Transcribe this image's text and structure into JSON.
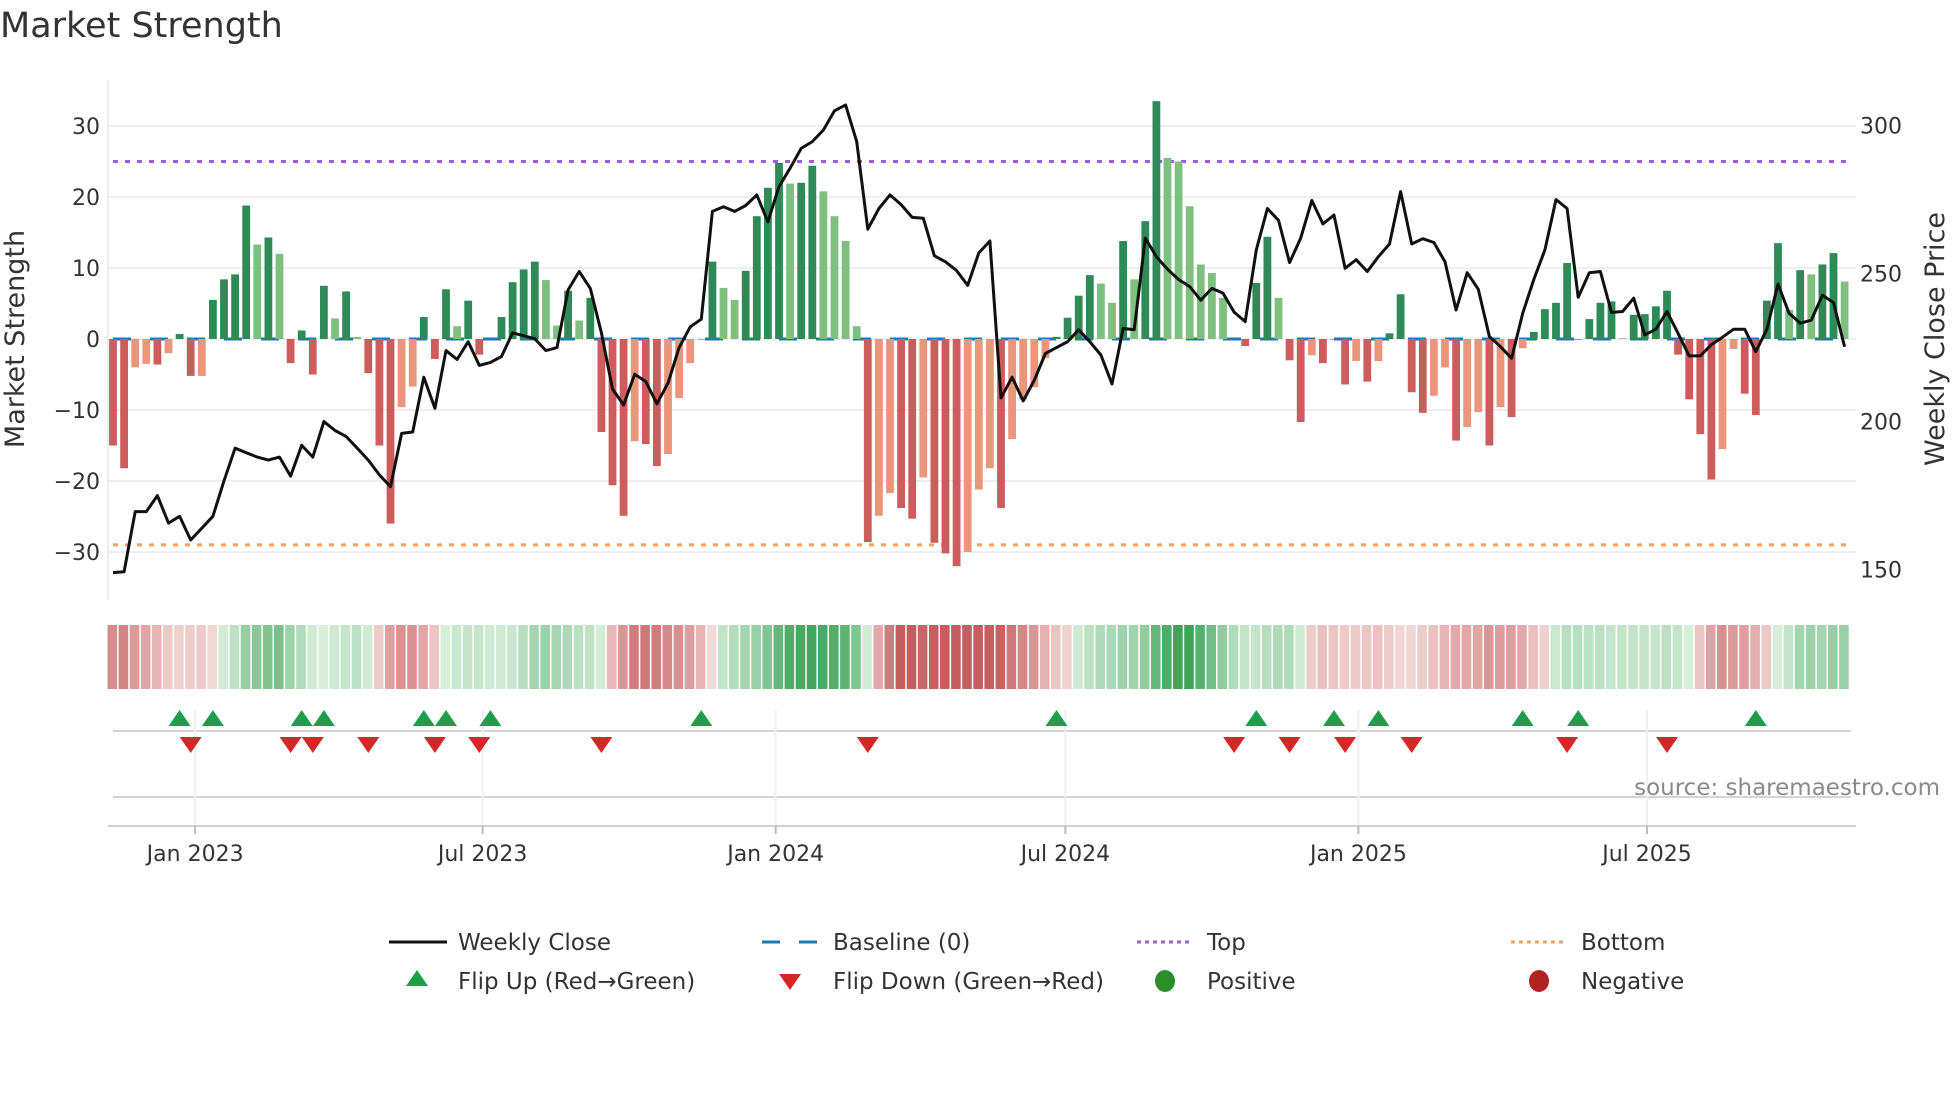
{
  "title": "Market Strength",
  "source": "source: sharemaestro.com",
  "colors": {
    "strong_green": "#2e8b57",
    "weak_green": "#7fbf7f",
    "strong_red": "#cd5c5c",
    "weak_red": "#e9967a",
    "price": "#111111",
    "baseline": "#1f77b4",
    "top": "#9b5fd9",
    "bottom": "#f4a261",
    "flip_up": "#1e9e4a",
    "flip_down": "#d62728",
    "positive": "#2a8f2a",
    "negative": "#b22222"
  },
  "chart_data": {
    "type": "bar+line",
    "title": "Market Strength",
    "ylabel": "Market Strength",
    "y2label": "Weekly Close Price",
    "ylim": [
      -37,
      37.5
    ],
    "y2lim": [
      136,
      320
    ],
    "yticks": [
      30,
      20,
      10,
      0,
      -10,
      -20,
      -30
    ],
    "y2ticks": [
      300,
      250,
      200,
      150
    ],
    "top_level": 25,
    "bottom_level": -29,
    "baseline": 0,
    "x_unit": "week index (weekly bars)",
    "xticks": [
      {
        "label": "Jan 2023",
        "week": 7.4
      },
      {
        "label": "Jul 2023",
        "week": 33.3
      },
      {
        "label": "Jan 2024",
        "week": 59.7
      },
      {
        "label": "Jul 2024",
        "week": 85.8
      },
      {
        "label": "Jan 2025",
        "week": 112.2
      },
      {
        "label": "Jul 2025",
        "week": 138.2
      }
    ],
    "strength": [
      -15,
      -18.2,
      -4,
      -3.5,
      -3.6,
      -2,
      0.7,
      -5.2,
      -5.2,
      5.5,
      8.4,
      9.1,
      18.8,
      13.3,
      14.3,
      12,
      -3.4,
      1.2,
      -5,
      7.5,
      2.9,
      6.7,
      0.3,
      -4.8,
      -15,
      -26,
      -9.6,
      -6.7,
      3.1,
      -2.8,
      7,
      1.8,
      5.4,
      -2.2,
      0,
      3.1,
      8,
      9.8,
      10.9,
      8.3,
      1.9,
      6.8,
      2.6,
      5.8,
      -13.1,
      -20.6,
      -24.9,
      -14.4,
      -14.8,
      -17.9,
      -16.2,
      -8.3,
      -3.4,
      0,
      10.9,
      7.2,
      5.5,
      9.6,
      17.3,
      21.3,
      24.8,
      21.9,
      22,
      24.4,
      20.8,
      17.3,
      13.8,
      1.8,
      -28.6,
      -24.9,
      -21.7,
      -23.8,
      -25.3,
      -19.5,
      -28.7,
      -30.2,
      -32,
      -30,
      -21.2,
      -18.2,
      -23.8,
      -14.1,
      -8.5,
      -6.8,
      -2.7,
      0.3,
      3,
      6.1,
      9,
      7.8,
      5.1,
      13.8,
      8.4,
      16.6,
      33.5,
      25.5,
      25,
      18.7,
      10.5,
      9.3,
      5.8,
      0,
      -1,
      7.9,
      14.4,
      5.8,
      -3,
      -11.7,
      -2.3,
      -3.4,
      0,
      -6.4,
      -3.1,
      -6,
      -3.1,
      0.8,
      6.3,
      -7.5,
      -10.4,
      -8,
      -4,
      -14.3,
      -12.4,
      -10.3,
      -15,
      -9.6,
      -11,
      -1.3,
      1,
      4.2,
      5.1,
      10.7,
      -0.1,
      2.8,
      5.1,
      5.3,
      0.1,
      3.4,
      3.5,
      4.6,
      6.8,
      -2.2,
      -8.5,
      -13.4,
      -19.8,
      -15.5,
      -1.4,
      -7.7,
      -10.7,
      5.4,
      13.5,
      4.1,
      9.7,
      9.1,
      10.5,
      12.1,
      8.1
    ],
    "strength_shade": "SSWWSWSSWSSSSWSWSSSSWSWSSSWWSSSWSSSSSSSWWSWSSSSWSSWWWSSWWSSSSWSSWWWWSWWSSWSSSWWWSWWWWSSSSWWSWSSWWWWWWSSSSWSSWSSSWSWSSSSWWSWWSWSWSSSSSSSSWSSSSSSSSWWSSSSWSWSSW",
    "weekly_close": [
      149,
      149.3,
      169.6,
      169.6,
      175,
      165.7,
      168,
      160,
      164,
      168,
      180,
      191,
      189.5,
      188,
      187,
      188,
      181.6,
      192,
      188,
      200,
      197,
      195,
      191,
      187,
      182,
      178,
      196,
      196.5,
      215,
      204.5,
      224,
      221,
      227,
      219,
      220,
      222,
      230,
      229,
      228,
      224,
      225,
      244.5,
      250.7,
      245,
      230,
      211,
      205.6,
      216,
      213.5,
      206,
      213,
      225,
      232,
      234.6,
      271,
      272.6,
      271,
      273,
      276.6,
      267.5,
      279.4,
      285.6,
      292.3,
      294.6,
      298.5,
      305,
      307,
      294.6,
      265,
      272,
      276.6,
      273.3,
      269,
      268.7,
      256,
      254,
      251,
      246,
      257,
      261,
      208,
      215,
      207,
      214,
      223,
      225,
      227,
      231,
      227,
      222.5,
      212.7,
      231.5,
      231,
      262,
      255.7,
      251.5,
      248,
      245.6,
      241,
      245,
      243.4,
      237,
      233.8,
      258,
      272,
      268,
      253.7,
      262,
      274.7,
      266.8,
      269.8,
      251.8,
      254.7,
      250.7,
      255.7,
      260,
      277.7,
      260,
      261.8,
      260.5,
      254,
      237.7,
      250.3,
      244.7,
      228.7,
      225.3,
      221.4,
      236.6,
      248,
      258,
      275,
      272,
      242,
      250.3,
      250.7,
      236.9,
      237.2,
      241.7,
      229.3,
      231.2,
      237.2,
      229.8,
      222.2,
      222.2,
      226,
      228.5,
      231.2,
      231.2,
      223.6,
      231.2,
      246.5,
      236.6,
      233.2,
      234.3,
      242.7,
      240.2,
      225.3
    ],
    "flip_up_weeks": [
      6,
      9,
      17,
      19,
      28,
      30,
      34,
      53,
      85,
      103,
      110,
      114,
      127,
      132,
      148
    ],
    "flip_down_weeks": [
      7,
      16,
      18,
      23,
      29,
      33,
      44,
      68,
      101,
      106,
      111,
      117,
      131,
      140
    ],
    "legend": {
      "placement": "bottom",
      "items": [
        {
          "label": "Weekly Close",
          "kind": "line"
        },
        {
          "label": "Baseline (0)",
          "kind": "dash"
        },
        {
          "label": "Top",
          "kind": "dot-purple"
        },
        {
          "label": "Bottom",
          "kind": "dot-orange"
        },
        {
          "label": "Flip Up (Red→Green)",
          "kind": "tri-up"
        },
        {
          "label": "Flip Down (Green→Red)",
          "kind": "tri-down"
        },
        {
          "label": "Positive",
          "kind": "circle-green"
        },
        {
          "label": "Negative",
          "kind": "circle-red"
        }
      ]
    }
  }
}
